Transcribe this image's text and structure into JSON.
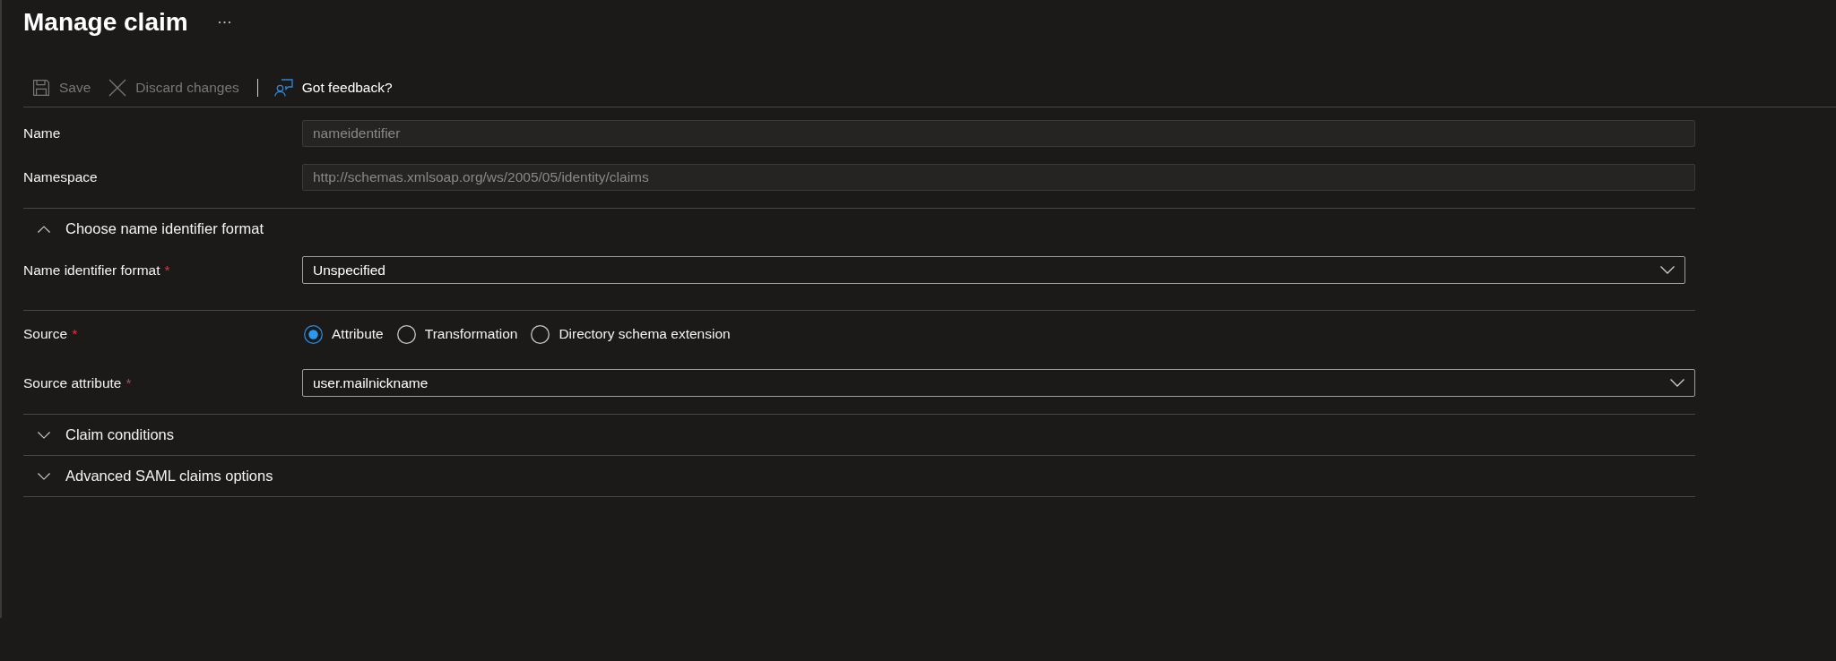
{
  "header": {
    "title": "Manage claim"
  },
  "toolbar": [
    {
      "kind": "save",
      "label": "Save",
      "disabled": true
    },
    {
      "kind": "discard",
      "label": "Discard changes",
      "disabled": true
    },
    {
      "kind": "separator"
    },
    {
      "kind": "feedback",
      "label": "Got feedback?",
      "disabled": false
    }
  ],
  "groups": [
    {
      "rows": [
        {
          "kind": "text",
          "label": "Name",
          "value": "nameidentifier",
          "disabled": true
        },
        {
          "kind": "text",
          "label": "Namespace",
          "value": "http://schemas.xmlsoap.org/ws/2005/05/identity/claims",
          "disabled": true
        }
      ]
    },
    {
      "section": {
        "title": "Choose name identifier format",
        "expanded": true
      },
      "rows": [
        {
          "kind": "dropdown",
          "label": "Name identifier format",
          "required_mark": "*",
          "value": "Unspecified"
        }
      ]
    },
    {
      "rows": [
        {
          "kind": "radio",
          "label": "Source",
          "required_mark": "*",
          "options": [
            {
              "label": "Attribute",
              "selected": true
            },
            {
              "label": "Transformation",
              "selected": false
            },
            {
              "label": "Directory schema extension",
              "selected": false
            }
          ]
        },
        {
          "kind": "dropdown",
          "label": "Source attribute",
          "required_mark": "*",
          "value": "user.mailnickname"
        }
      ]
    },
    {
      "section": {
        "title": "Claim conditions",
        "expanded": false
      }
    },
    {
      "section": {
        "title": "Advanced SAML claims options",
        "expanded": false
      }
    }
  ]
}
